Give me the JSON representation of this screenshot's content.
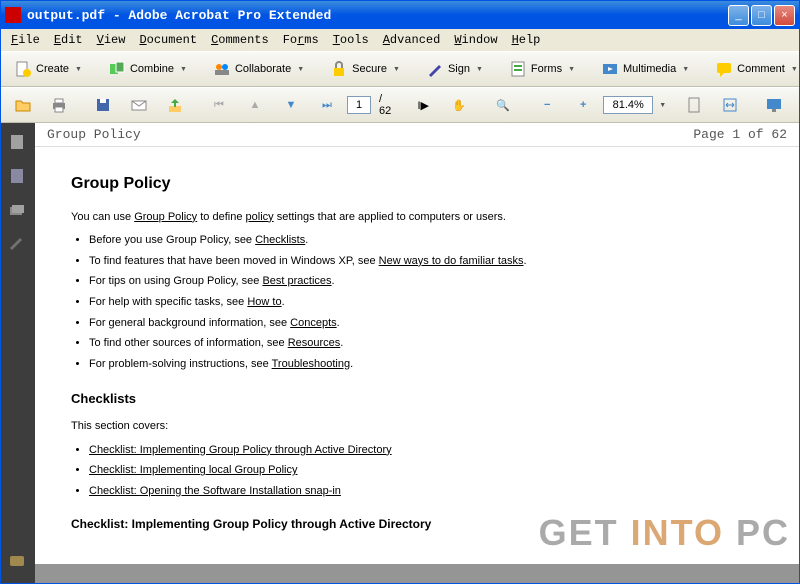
{
  "titlebar": {
    "text": "output.pdf - Adobe Acrobat Pro Extended"
  },
  "menubar": {
    "items": [
      "File",
      "Edit",
      "View",
      "Document",
      "Comments",
      "Forms",
      "Tools",
      "Advanced",
      "Window",
      "Help"
    ]
  },
  "toolbar1": {
    "create": "Create",
    "combine": "Combine",
    "collaborate": "Collaborate",
    "secure": "Secure",
    "sign": "Sign",
    "forms": "Forms",
    "multimedia": "Multimedia",
    "comment": "Comment"
  },
  "toolbar2": {
    "page_current": "1",
    "page_total": "/ 62",
    "zoom": "81.4%"
  },
  "doc_header": {
    "left": "Group Policy",
    "right": "Page 1 of 62"
  },
  "document": {
    "h1": "Group Policy",
    "intro_pre": "You can use ",
    "intro_link1": "Group Policy",
    "intro_mid": " to define ",
    "intro_link2": "policy",
    "intro_post": " settings that are applied to computers or users.",
    "bullets": [
      {
        "pre": "Before you use Group Policy, see ",
        "link": "Checklists",
        "post": "."
      },
      {
        "pre": "To find features that have been moved in Windows XP, see ",
        "link": "New ways to do familiar tasks",
        "post": "."
      },
      {
        "pre": "For tips on using Group Policy, see ",
        "link": "Best practices",
        "post": "."
      },
      {
        "pre": "For help with specific tasks, see ",
        "link": "How to",
        "post": "."
      },
      {
        "pre": "For general background information, see ",
        "link": "Concepts",
        "post": "."
      },
      {
        "pre": "To find other sources of information, see ",
        "link": "Resources",
        "post": "."
      },
      {
        "pre": "For problem-solving instructions, see ",
        "link": "Troubleshooting",
        "post": "."
      }
    ],
    "h2": "Checklists",
    "section_intro": "This section covers:",
    "checklist_links": [
      "Checklist: Implementing Group Policy through Active Directory",
      "Checklist: Implementing local Group Policy",
      "Checklist: Opening the Software Installation snap-in"
    ],
    "h3": "Checklist: Implementing Group Policy through Active Directory"
  },
  "watermark": {
    "p1": "GET",
    "p2": "INTO",
    "p3": "PC"
  }
}
